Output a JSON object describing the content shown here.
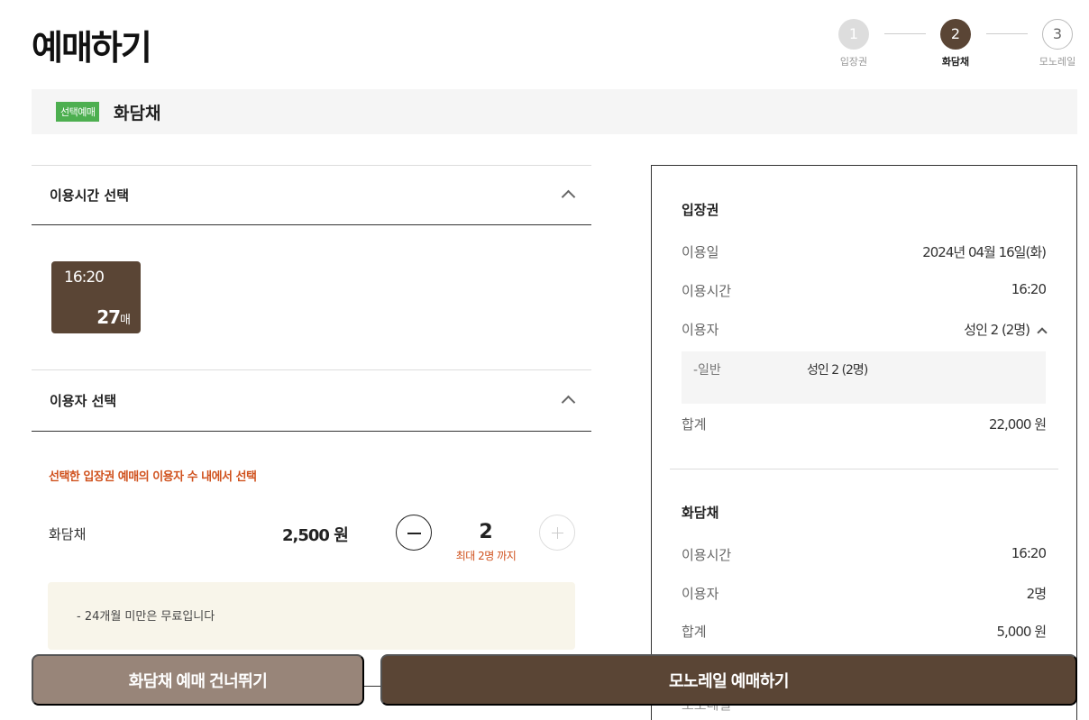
{
  "page": {
    "title": "예매하기"
  },
  "steps": [
    {
      "num": "1",
      "label": "입장권",
      "state": "done"
    },
    {
      "num": "2",
      "label": "화담채",
      "state": "active"
    },
    {
      "num": "3",
      "label": "모노레일",
      "state": "todo"
    }
  ],
  "selection": {
    "badge": "선택예매",
    "name": "화담채"
  },
  "time_section": {
    "title": "이용시간 선택",
    "slot": {
      "time": "16:20",
      "count": "27",
      "unit": "매"
    }
  },
  "user_section": {
    "title": "이용자 선택",
    "notice": "선택한 입장권 예매의 이용자 수 내에서 선택",
    "item": {
      "name": "화담채",
      "price": "2,500 원",
      "quantity": "2",
      "max_note": "최대 2명 까지"
    },
    "info": "-  24개월 미만은 무료입니다"
  },
  "summary": {
    "ticket": {
      "title": "입장권",
      "date_label": "이용일",
      "date_value": "2024년 04월 16일(화)",
      "time_label": "이용시간",
      "time_value": "16:20",
      "user_label": "이용자",
      "user_value": "성인 2 (2명)",
      "sub_label": "-일반",
      "sub_value": "성인 2 (2명)",
      "total_label": "합계",
      "total_value": "22,000 원"
    },
    "hwadamchae": {
      "title": "화담채",
      "time_label": "이용시간",
      "time_value": "16:20",
      "user_label": "이용자",
      "user_value": "2명",
      "total_label": "합계",
      "total_value": "5,000 원"
    },
    "monorail_partial": "모노레일"
  },
  "actions": {
    "skip": "화담채 예매 건너뛰기",
    "next": "모노레일 예매하기"
  },
  "colors": {
    "brand": "#5a4535",
    "accent_red": "#d0521e",
    "badge_green": "#4daf50"
  }
}
